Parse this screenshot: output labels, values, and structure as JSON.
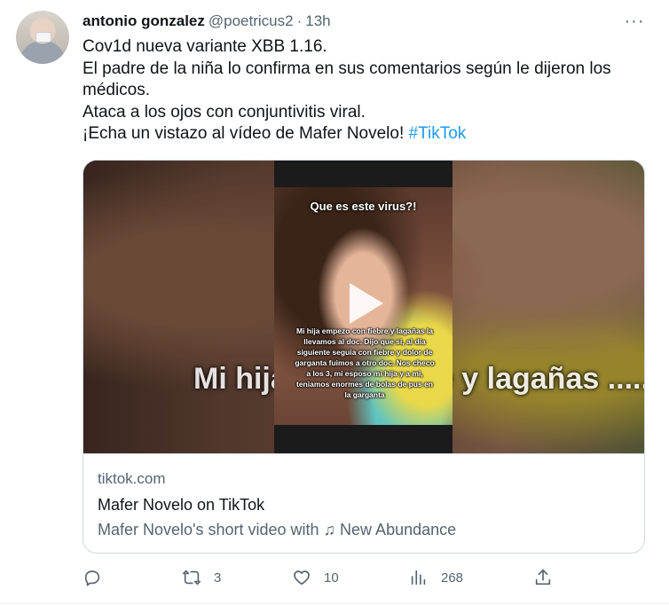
{
  "author": {
    "name": "antonio gonzalez",
    "handle": "@poetricus2",
    "separator": "·",
    "time": "13h"
  },
  "more_label": "···",
  "tweet": {
    "lines": [
      "Cov1d nueva variante XBB 1.16.",
      "El padre de la niña lo confirma en sus comentarios según le dijeron los médicos.",
      "Ataca a los ojos con conjuntivitis viral."
    ],
    "last_line_text": "¡Echa un vistazo al vídeo de Mafer Novelo! ",
    "hashtag": "#TikTok"
  },
  "card": {
    "video_caption_top": "Que es este virus?!",
    "video_caption_overlay": "Mi hija empezo con fiebre y lagañas la llevamos al doc. Dijo que si, al dia siguiente seguia con fiebre y dolor de garganta fuimos a otro doc. Nos checo a los 3, mi esposo mi hija y a mi, teniamos enormes de bolas de pus en la garganta",
    "background_text": "Mi hija ........ fiebre y lagañas ........ al doc. Dijo q ........ siguiente",
    "domain": "tiktok.com",
    "title": "Mafer Novelo on TikTok",
    "description": "Mafer Novelo's short video with ♫ New Abundance"
  },
  "actions": {
    "reply_count": "",
    "retweet_count": "3",
    "like_count": "10",
    "views_count": "268"
  },
  "colors": {
    "link": "#1d9bf0",
    "secondary_text": "#536471",
    "border": "#cfd9de"
  }
}
